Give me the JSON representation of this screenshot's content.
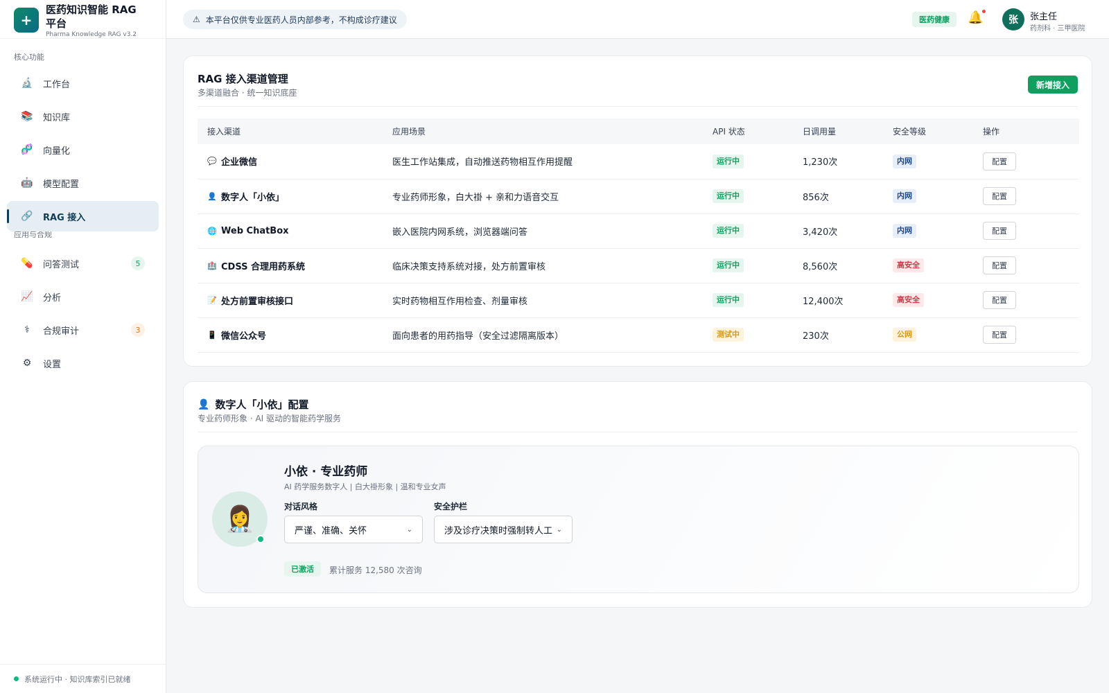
{
  "brand": {
    "title": "医药知识智能 RAG 平台",
    "subtitle": "Pharma Knowledge RAG v3.2",
    "logo_symbol": "+"
  },
  "sidebar": {
    "section_core": "核心功能",
    "section_apps": "应用与合规",
    "core_items": [
      {
        "icon": "microscope-icon",
        "glyph": "🔬",
        "label": "工作台"
      },
      {
        "icon": "books-icon",
        "glyph": "📚",
        "label": "知识库"
      },
      {
        "icon": "dna-icon",
        "glyph": "🧬",
        "label": "向量化"
      },
      {
        "icon": "robot-icon",
        "glyph": "🤖",
        "label": "模型配置"
      },
      {
        "icon": "link-icon",
        "glyph": "🔗",
        "label": "RAG 接入",
        "active": true
      }
    ],
    "app_items": [
      {
        "icon": "pill-icon",
        "glyph": "💊",
        "label": "问答测试",
        "badge": "5"
      },
      {
        "icon": "chart-icon",
        "glyph": "📈",
        "label": "分析"
      },
      {
        "icon": "medical-symbol-icon",
        "glyph": "⚕",
        "label": "合规审计",
        "badge": "3"
      },
      {
        "icon": "gear-icon",
        "glyph": "⚙",
        "label": "设置"
      }
    ],
    "status_text": "系统运行中 · 知识库索引已就绪"
  },
  "header": {
    "notice": "本平台仅供专业医药人员内部参考，不构成诊疗建议",
    "notice_icon": "⚠",
    "tag": "医药健康",
    "user_avatar": "张",
    "user_name": "张主任",
    "user_dept": "药剂科 · 三甲医院"
  },
  "channels_card": {
    "title": "RAG 接入渠道管理",
    "subtitle": "多渠道融合 · 统一知识底座",
    "add_button": "新增接入",
    "columns": [
      "接入渠道",
      "应用场景",
      "API 状态",
      "日调用量",
      "安全等级",
      "操作"
    ],
    "rows": [
      {
        "icon": "chat-bubble-icon",
        "glyph": "💬",
        "name": "企业微信",
        "scene": "医生工作站集成，自动推送药物相互作用提醒",
        "status": "运行中",
        "status_type": "run",
        "calls": "1,230次",
        "security": "内网",
        "security_type": "inner",
        "action": "配置"
      },
      {
        "icon": "person-icon",
        "glyph": "👤",
        "name": "数字人「小依」",
        "scene": "专业药师形象，白大褂 + 亲和力语音交互",
        "status": "运行中",
        "status_type": "run",
        "calls": "856次",
        "security": "内网",
        "security_type": "inner",
        "action": "配置"
      },
      {
        "icon": "globe-icon",
        "glyph": "🌐",
        "name": "Web ChatBox",
        "scene": "嵌入医院内网系统，浏览器端问答",
        "status": "运行中",
        "status_type": "run",
        "calls": "3,420次",
        "security": "内网",
        "security_type": "inner",
        "action": "配置"
      },
      {
        "icon": "hospital-icon",
        "glyph": "🏥",
        "name": "CDSS 合理用药系统",
        "scene": "临床决策支持系统对接，处方前置审核",
        "status": "运行中",
        "status_type": "run",
        "calls": "8,560次",
        "security": "高安全",
        "security_type": "high",
        "action": "配置"
      },
      {
        "icon": "memo-icon",
        "glyph": "📝",
        "name": "处方前置审核接口",
        "scene": "实时药物相互作用检查、剂量审核",
        "status": "运行中",
        "status_type": "run",
        "calls": "12,400次",
        "security": "高安全",
        "security_type": "high",
        "action": "配置"
      },
      {
        "icon": "mobile-phone-icon",
        "glyph": "📱",
        "name": "微信公众号",
        "scene": "面向患者的用药指导（安全过滤隔离版本）",
        "status": "测试中",
        "status_type": "test",
        "calls": "230次",
        "security": "公网",
        "security_type": "public",
        "action": "配置"
      }
    ]
  },
  "persona_card": {
    "title": "数字人「小依」配置",
    "title_glyph": "👤",
    "subtitle": "专业药师形象 · AI 驱动的智能药学服务",
    "avatar_glyph": "👩‍⚕️",
    "name": "小依 · 专业药师",
    "desc": "AI 药学服务数字人 | 白大褂形象 | 温和专业女声",
    "style_label": "对话风格",
    "style_value": "严谨、准确、关怀",
    "guard_label": "安全护栏",
    "guard_value": "涉及诊疗决策时强制转人工",
    "active_tag": "已激活",
    "served_text": "累计服务 12,580 次咨询"
  },
  "colors": {
    "primary_green": "#0f9f5f",
    "active_nav": "#0f3d55",
    "danger": "#d13a48",
    "warning": "#d99a10"
  }
}
